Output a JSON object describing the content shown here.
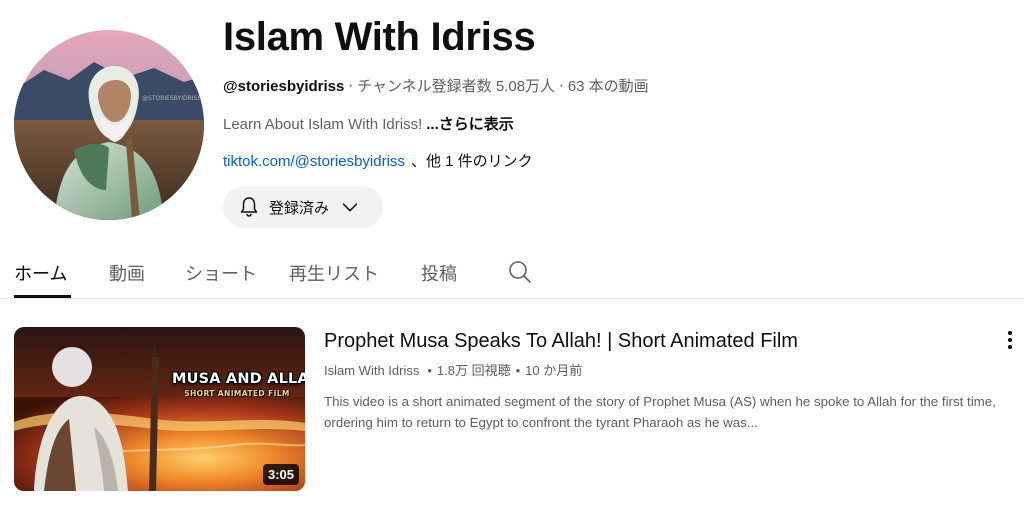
{
  "channel": {
    "name": "Islam With Idriss",
    "handle": "@storiesbyidriss",
    "subscribers": "チャンネル登録者数 5.08万人",
    "video_count": "63 本の動画",
    "separator": "‧",
    "description": "Learn About Islam With Idriss!",
    "more_label": "...さらに表示",
    "link_text": "tiktok.com/@storiesbyidriss",
    "link_extra": "、他 1 件のリンク",
    "avatar_watermark": "@STORIESBYIDRISS",
    "subscribe_label": "登録済み"
  },
  "tabs": [
    {
      "label": "ホーム",
      "active": true
    },
    {
      "label": "動画"
    },
    {
      "label": "ショート"
    },
    {
      "label": "再生リスト"
    },
    {
      "label": "投稿"
    }
  ],
  "icons": {
    "bell": "bell-icon",
    "chevron": "chevron-down-icon",
    "search": "search-icon",
    "more": "more-vert-icon"
  },
  "video": {
    "title": "Prophet Musa Speaks To Allah! | Short Animated Film",
    "channel": "Islam With Idriss",
    "views": "1.8万 回視聴",
    "age": "10 か月前",
    "separator": "•",
    "description": "This video is a short animated segment of the story of Prophet Musa (AS) when he spoke to Allah for the first time, ordering him to return to Egypt to confront the tyrant Pharaoh as he was...",
    "duration": "3:05",
    "thumbnail_title": "MUSA AND ALLAH",
    "thumbnail_subtitle": "SHORT ANIMATED FILM"
  },
  "colors": {
    "link": "#065fd4",
    "text_primary": "#0f0f0f",
    "text_secondary": "#606060",
    "button_bg": "#f2f2f2"
  }
}
